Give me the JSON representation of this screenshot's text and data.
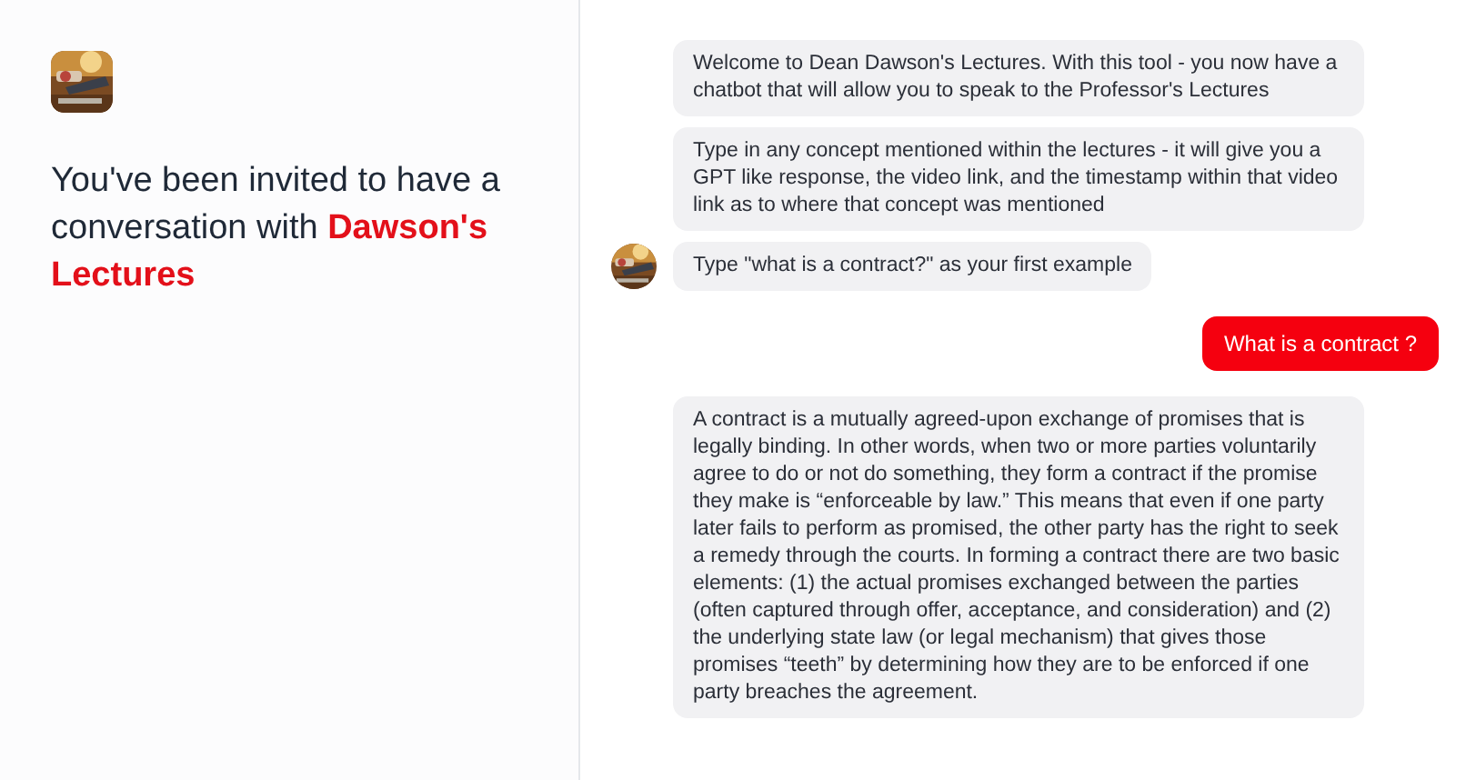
{
  "intro": {
    "heading": "You've been invited to have a conversation with **Dawson's Lectures**"
  },
  "messages": [
    {
      "kind": "bot",
      "avatar": false,
      "text": "Welcome to Dean Dawson's Lectures. With this tool - you now have a chatbot that will allow you to speak to the Professor's Lectures"
    },
    {
      "kind": "bot",
      "avatar": false,
      "text": "Type in any concept mentioned within the lectures - it will give you a GPT like response, the video link, and the timestamp within that video link as to where that concept was mentioned"
    },
    {
      "kind": "bot",
      "avatar": true,
      "text": "Type \"what is a contract?\" as your first example"
    },
    {
      "kind": "user",
      "text": "What is a contract ?"
    },
    {
      "kind": "bot",
      "avatar": false,
      "text": "A contract is a mutually agreed-upon exchange of promises that is legally binding. In other words, when two or more parties voluntarily agree to do or not do something, they form a contract if the promise they make is “enforceable by law.” This means that even if one party later fails to perform as promised, the other party has the right to seek a remedy through the courts. In forming a contract there are two basic elements: (1) the actual promises exchanged between the parties (often captured through offer, acceptance, and consideration) and (2) the underlying state law (or legal mechanism) that gives those promises “teeth” by determining how they are to be enforced if one party breaches the agreement."
    }
  ]
}
